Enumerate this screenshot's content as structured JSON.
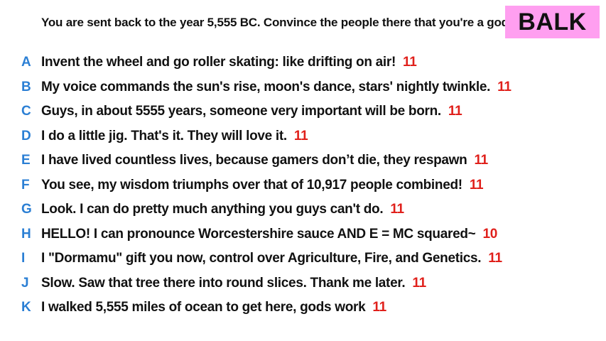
{
  "prompt": "You are sent back to the year 5,555 BC. Convince the people there that you're a god.",
  "badge": "BALK",
  "colors": {
    "badge_bg": "#ff9ff0",
    "letter": "#2b7fd4",
    "score": "#e0201b"
  },
  "answers": [
    {
      "letter": "A",
      "text": "Invent the wheel and go roller skating: like drifting on air!",
      "score": "11"
    },
    {
      "letter": "B",
      "text": "My voice commands the sun's rise, moon's dance, stars' nightly twinkle.",
      "score": "11"
    },
    {
      "letter": "C",
      "text": "Guys, in about 5555 years, someone very important will be born.",
      "score": "11"
    },
    {
      "letter": "D",
      "text": "I do a little jig. That's it. They will love it.",
      "score": "11"
    },
    {
      "letter": "E",
      "text": "I have lived countless lives, because gamers don’t die, they respawn",
      "score": "11"
    },
    {
      "letter": "F",
      "text": "You see, my wisdom triumphs over that of 10,917 people combined!",
      "score": "11"
    },
    {
      "letter": "G",
      "text": "Look. I can do pretty much anything you guys can't do.",
      "score": "11"
    },
    {
      "letter": "H",
      "text": "HELLO! I can pronounce Worcestershire sauce AND E = MC squared~",
      "score": "10"
    },
    {
      "letter": "I",
      "text": "I \"Dormamu\"  gift you now, control over Agriculture, Fire, and Genetics.",
      "score": "11"
    },
    {
      "letter": "J",
      "text": "Slow. Saw that tree there into round slices. Thank me later.",
      "score": "11"
    },
    {
      "letter": "K",
      "text": "I walked 5,555 miles of ocean to get here, gods work",
      "score": "11"
    }
  ]
}
